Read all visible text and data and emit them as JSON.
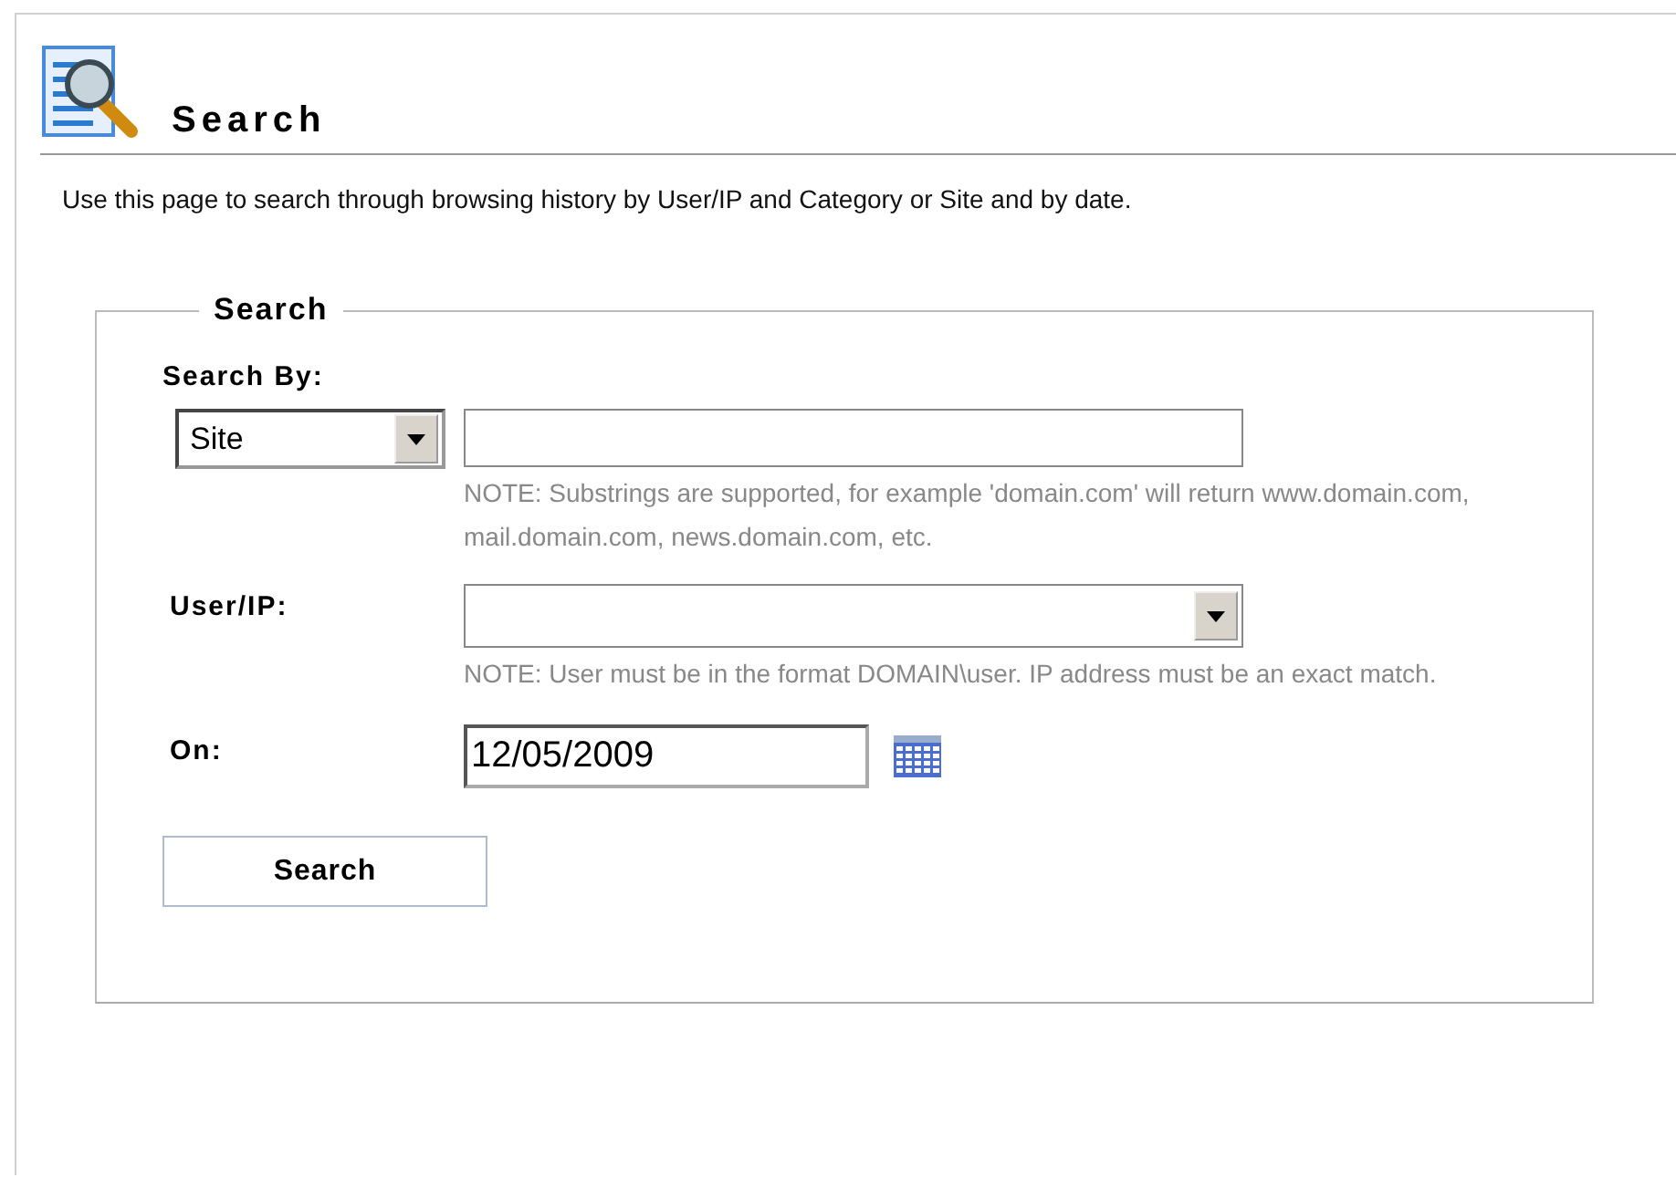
{
  "header": {
    "title": "Search"
  },
  "description": "Use this page to search through browsing history by User/IP and Category or Site and by date.",
  "form": {
    "legend": "Search",
    "search_by": {
      "label": "Search By:",
      "select_value": "Site",
      "note": "NOTE: Substrings are supported, for example 'domain.com' will return www.domain.com, mail.domain.com, news.domain.com, etc."
    },
    "user_ip": {
      "label": "User/IP:",
      "note": "NOTE: User must be in the format DOMAIN\\user. IP address must be an exact match."
    },
    "on": {
      "label": "On:",
      "value": "12/05/2009"
    },
    "button": "Search"
  }
}
